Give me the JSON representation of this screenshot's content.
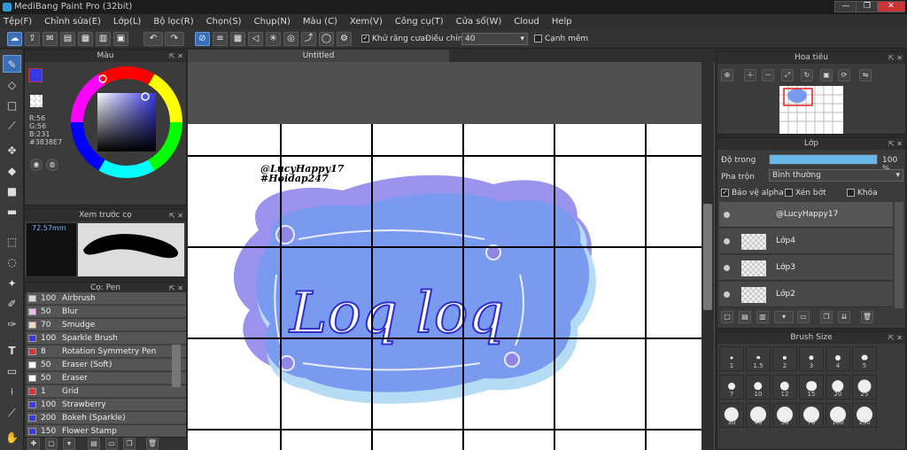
{
  "window": {
    "title": "MediBang Paint Pro (32bit)",
    "min": "—",
    "max": "❐",
    "close": "✕"
  },
  "menu": [
    "Tệp(F)",
    "Chỉnh sửa(E)",
    "Lớp(L)",
    "Bộ lọc(R)",
    "Chọn(S)",
    "Chụp(N)",
    "Màu (C)",
    "Xem(V)",
    "Công cụ(T)",
    "Cửa sổ(W)",
    "Cloud",
    "Help"
  ],
  "toolbar": {
    "antialias_label": "Khử răng cưa",
    "smooth_label": "Điều chỉnh",
    "smooth_value": "40",
    "snap_label": "Cạnh mềm"
  },
  "color_panel": {
    "title": "Màu",
    "r": "R:56",
    "g": "G:56",
    "b": "B:231",
    "hex": "#3838E7",
    "fg": "#3838E7"
  },
  "brush_preview": {
    "title": "Xem trước cọ",
    "size": "72.57mm"
  },
  "brush_panel": {
    "title": "Cọ: Pen",
    "items": [
      {
        "size": "100",
        "name": "Airbrush",
        "color": "#d8d8d8"
      },
      {
        "size": "50",
        "name": "Blur",
        "color": "#f4b6f0"
      },
      {
        "size": "70",
        "name": "Smudge",
        "color": "#f0d8c0"
      },
      {
        "size": "100",
        "name": "Sparkle Brush",
        "color": "#3838e7"
      },
      {
        "size": "8",
        "name": "Rotation Symmetry Pen",
        "color": "#e03030"
      },
      {
        "size": "50",
        "name": "Eraser (Soft)",
        "color": "#ffffff"
      },
      {
        "size": "50",
        "name": "Eraser",
        "color": "#ffffff"
      },
      {
        "size": "1",
        "name": "Grid",
        "color": "#e03030"
      },
      {
        "size": "100",
        "name": "Strawberry",
        "color": "#3838e7"
      },
      {
        "size": "200",
        "name": "Bokeh (Sparkle)",
        "color": "#3838e7"
      },
      {
        "size": "150",
        "name": "Flower Stamp",
        "color": "#3838e7"
      }
    ]
  },
  "document": {
    "tab": "Untitled",
    "credit1": "@LucyHappy17",
    "credit2": "#Hoidap247",
    "art_text": "Loq loq"
  },
  "navigator": {
    "title": "Hoa tiêu"
  },
  "layer_panel": {
    "title": "Lớp",
    "opacity_label": "Độ trong",
    "opacity_value": "100 %",
    "opacity": 1.0,
    "blend_label": "Pha trộn",
    "blend_value": "Bình thường",
    "protect_alpha": "Bảo vệ alpha",
    "clipping": "Xén bớt",
    "lock": "Khóa",
    "layers": [
      {
        "name": "@LucyHappy17"
      },
      {
        "name": "Lớp4"
      },
      {
        "name": "Lớp3"
      },
      {
        "name": "Lớp2"
      }
    ]
  },
  "brush_size_panel": {
    "title": "Brush Size",
    "sizes": [
      "1",
      "1.5",
      "2",
      "3",
      "4",
      "5",
      "7",
      "10",
      "12",
      "15",
      "20",
      "25",
      "30",
      "40",
      "50",
      "70",
      "100",
      "150"
    ]
  }
}
